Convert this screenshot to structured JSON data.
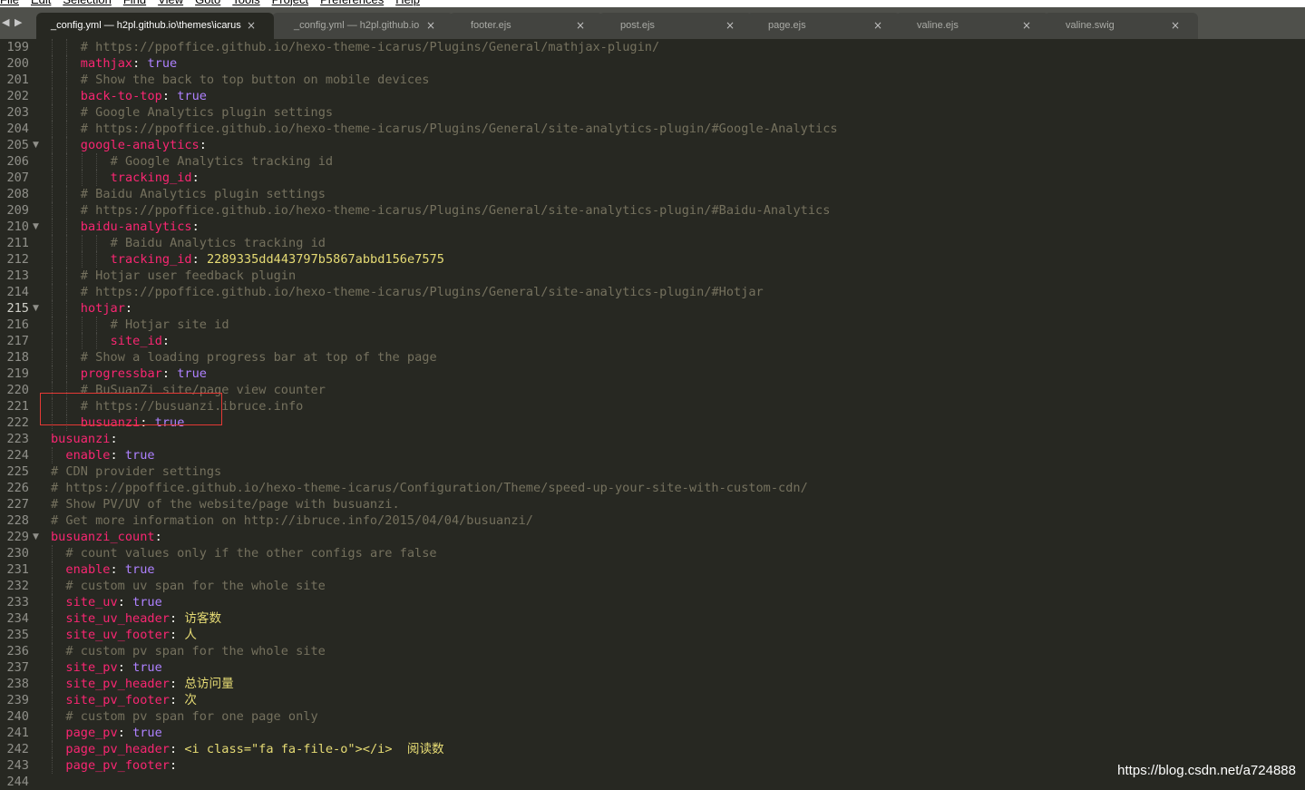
{
  "menu": [
    "File",
    "Edit",
    "Selection",
    "Find",
    "View",
    "Goto",
    "Tools",
    "Project",
    "Preferences",
    "Help"
  ],
  "tabs": [
    {
      "label": "_config.yml — h2pl.github.io\\themes\\icarus",
      "active": true
    },
    {
      "label": "_config.yml — h2pl.github.io",
      "active": false
    },
    {
      "label": "footer.ejs",
      "active": false
    },
    {
      "label": "post.ejs",
      "active": false
    },
    {
      "label": "page.ejs",
      "active": false
    },
    {
      "label": "valine.ejs",
      "active": false
    },
    {
      "label": "valine.swig",
      "active": false
    }
  ],
  "close_glyph": "×",
  "current_line": 215,
  "colors": {
    "background": "#272822",
    "key": "#f92672",
    "boolean": "#ae81ff",
    "string": "#e6db74",
    "comment": "#75715e",
    "highlight_box": "#e53935"
  },
  "lines": [
    {
      "n": "199",
      "i": 4,
      "c": "# https://ppoffice.github.io/hexo-theme-icarus/Plugins/General/mathjax-plugin/"
    },
    {
      "n": "200",
      "i": 4,
      "k": "mathjax",
      "t": "true"
    },
    {
      "n": "201",
      "i": 4,
      "c": "# Show the back to top button on mobile devices"
    },
    {
      "n": "202",
      "i": 4,
      "k": "back-to-top",
      "t": "true"
    },
    {
      "n": "203",
      "i": 4,
      "c": "# Google Analytics plugin settings"
    },
    {
      "n": "204",
      "i": 4,
      "c": "# https://ppoffice.github.io/hexo-theme-icarus/Plugins/General/site-analytics-plugin/#Google-Analytics"
    },
    {
      "n": "205",
      "i": 4,
      "k": "google-analytics",
      "fold": true
    },
    {
      "n": "206",
      "i": 8,
      "c": "# Google Analytics tracking id"
    },
    {
      "n": "207",
      "i": 8,
      "k": "tracking_id"
    },
    {
      "n": "208",
      "i": 4,
      "c": "# Baidu Analytics plugin settings"
    },
    {
      "n": "209",
      "i": 4,
      "c": "# https://ppoffice.github.io/hexo-theme-icarus/Plugins/General/site-analytics-plugin/#Baidu-Analytics"
    },
    {
      "n": "210",
      "i": 4,
      "k": "baidu-analytics",
      "fold": true
    },
    {
      "n": "211",
      "i": 8,
      "c": "# Baidu Analytics tracking id"
    },
    {
      "n": "212",
      "i": 8,
      "k": "tracking_id",
      "s": "2289335dd443797b5867abbd156e7575"
    },
    {
      "n": "213",
      "i": 4,
      "c": "# Hotjar user feedback plugin"
    },
    {
      "n": "214",
      "i": 4,
      "c": "# https://ppoffice.github.io/hexo-theme-icarus/Plugins/General/site-analytics-plugin/#Hotjar"
    },
    {
      "n": "215",
      "i": 4,
      "k": "hotjar",
      "fold": true
    },
    {
      "n": "216",
      "i": 8,
      "c": "# Hotjar site id"
    },
    {
      "n": "217",
      "i": 8,
      "k": "site_id"
    },
    {
      "n": "218",
      "i": 4,
      "c": "# Show a loading progress bar at top of the page"
    },
    {
      "n": "219",
      "i": 4,
      "k": "progressbar",
      "t": "true"
    },
    {
      "n": "220",
      "i": 4,
      "c": "# BuSuanZi site/page view counter"
    },
    {
      "n": "221",
      "i": 4,
      "c": "# https://busuanzi.ibruce.info"
    },
    {
      "n": "222",
      "i": 4,
      "k": "busuanzi",
      "t": "true"
    },
    {
      "n": "223",
      "i": 0,
      "k": "busuanzi"
    },
    {
      "n": "224",
      "i": 2,
      "k": "enable",
      "t": "true"
    },
    {
      "n": "225",
      "i": 0,
      "c": "# CDN provider settings"
    },
    {
      "n": "226",
      "i": 0,
      "c": "# https://ppoffice.github.io/hexo-theme-icarus/Configuration/Theme/speed-up-your-site-with-custom-cdn/"
    },
    {
      "n": "227",
      "i": 0,
      "c": "# Show PV/UV of the website/page with busuanzi."
    },
    {
      "n": "228",
      "i": 0,
      "c": "# Get more information on http://ibruce.info/2015/04/04/busuanzi/"
    },
    {
      "n": "229",
      "i": 0,
      "k": "busuanzi_count",
      "fold": true
    },
    {
      "n": "230",
      "i": 2,
      "c": "# count values only if the other configs are false"
    },
    {
      "n": "231",
      "i": 2,
      "k": "enable",
      "t": "true"
    },
    {
      "n": "232",
      "i": 2,
      "c": "# custom uv span for the whole site"
    },
    {
      "n": "233",
      "i": 2,
      "k": "site_uv",
      "t": "true"
    },
    {
      "n": "234",
      "i": 2,
      "k": "site_uv_header",
      "s": "访客数"
    },
    {
      "n": "235",
      "i": 2,
      "k": "site_uv_footer",
      "s": "人"
    },
    {
      "n": "236",
      "i": 2,
      "c": "# custom pv span for the whole site"
    },
    {
      "n": "237",
      "i": 2,
      "k": "site_pv",
      "t": "true"
    },
    {
      "n": "238",
      "i": 2,
      "k": "site_pv_header",
      "s": "总访问量"
    },
    {
      "n": "239",
      "i": 2,
      "k": "site_pv_footer",
      "s": "次"
    },
    {
      "n": "240",
      "i": 2,
      "c": "# custom pv span for one page only"
    },
    {
      "n": "241",
      "i": 2,
      "k": "page_pv",
      "t": "true"
    },
    {
      "n": "242",
      "i": 2,
      "k": "page_pv_header",
      "s": "<i class=\"fa fa-file-o\"></i>  阅读数"
    },
    {
      "n": "243",
      "i": 2,
      "k": "page_pv_footer"
    },
    {
      "n": "244",
      "i": 0
    }
  ],
  "watermark": "https://blog.csdn.net/a724888"
}
